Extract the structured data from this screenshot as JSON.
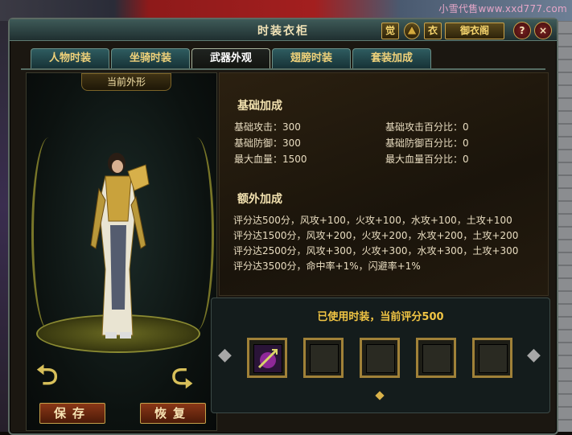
{
  "watermark": "小雪代售www.xxd777.com",
  "window": {
    "title": "时装衣柜",
    "buttons": {
      "awaken": "觉",
      "clothes": "衣",
      "wardrobe_pavilion": "御衣阁",
      "help": "?",
      "close": "×"
    }
  },
  "tabs": [
    {
      "label": "人物时装"
    },
    {
      "label": "坐骑时装"
    },
    {
      "label": "武器外观",
      "active": true
    },
    {
      "label": "翅膀时装"
    },
    {
      "label": "套装加成"
    }
  ],
  "left": {
    "label": "当前外形",
    "save_label": "保存",
    "restore_label": "恢复"
  },
  "basic": {
    "title": "基础加成",
    "attack": "基础攻击：300",
    "defense": "基础防御：300",
    "hp": "最大血量：1500",
    "attack_pct": "基础攻击百分比：0",
    "defense_pct": "基础防御百分比：0",
    "hp_pct": "最大血量百分比：0"
  },
  "extra": {
    "title": "额外加成",
    "lines": [
      "评分达500分，风攻+100，火攻+100，水攻+100，土攻+100",
      "评分达1500分，风攻+200，火攻+200，水攻+200，土攻+200",
      "评分达2500分，风攻+300，火攻+300，水攻+300，土攻+300",
      "评分达3500分，命中率+1%，闪避率+1%"
    ]
  },
  "slots": {
    "score_text": "已使用时装，当前评分500",
    "items": [
      "weapon-item",
      "empty",
      "empty",
      "empty",
      "empty"
    ]
  },
  "colors": {
    "accent": "#f1c544",
    "frame": "#5d6a63",
    "tab": "#2f5c60"
  }
}
